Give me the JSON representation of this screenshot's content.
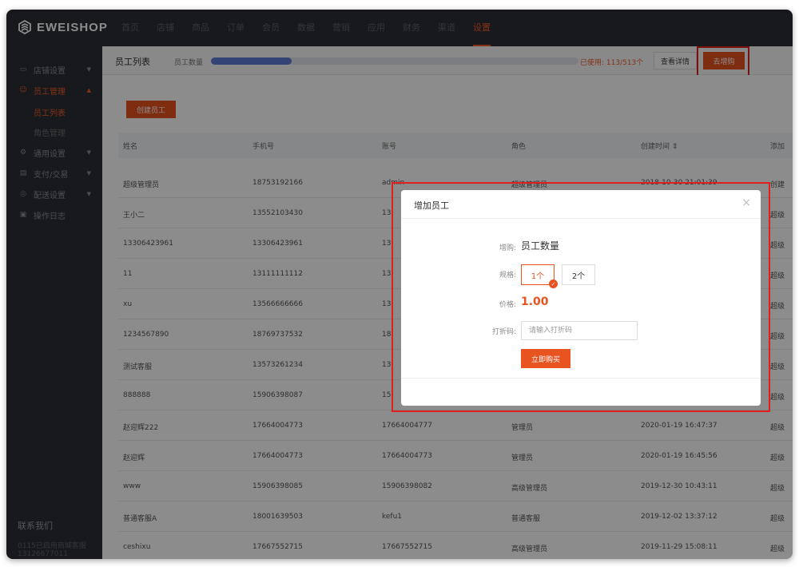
{
  "app": {
    "logo_text": "EWEISHOP"
  },
  "nav": [
    "首页",
    "店铺",
    "商品",
    "订单",
    "会员",
    "数据",
    "营销",
    "应用",
    "财务",
    "渠道",
    "设置"
  ],
  "nav_active_index": 10,
  "sidebar": {
    "groups": [
      {
        "label": "店铺设置",
        "icon": "shop-icon",
        "caret": "▼"
      },
      {
        "label": "员工管理",
        "icon": "staff-icon",
        "caret": "▲"
      },
      {
        "label": "通用设置",
        "icon": "gear-icon",
        "caret": "▼"
      },
      {
        "label": "支付/交易",
        "icon": "card-icon",
        "caret": "▼"
      },
      {
        "label": "配送设置",
        "icon": "delivery-icon",
        "caret": "▼"
      },
      {
        "label": "操作日志",
        "icon": "log-icon",
        "caret": ""
      }
    ],
    "subitems": [
      "员工列表",
      "角色管理"
    ],
    "contact_title": "联系我们",
    "contact_lines": [
      "0115已启用商城客服",
      "13126677011"
    ]
  },
  "toolbar": {
    "title": "员工列表",
    "quota_label": "员工数量",
    "usage_fraction": 0.22,
    "used_text": "已使用: 113/513个",
    "detail_button": "查看详情",
    "buy_button": "去增购"
  },
  "create_button": "创建员工",
  "table": {
    "columns": [
      "姓名",
      "手机号",
      "账号",
      "角色",
      "创建时间 ⇕",
      "添加"
    ],
    "rows": [
      [
        "超级管理员",
        "18753192166",
        "admin",
        "超级管理员",
        "2018-10-30 21:01:39",
        "创建"
      ],
      [
        "王小二",
        "13552103430",
        "13",
        "",
        "",
        "超级"
      ],
      [
        "13306423961",
        "13306423961",
        "13",
        "",
        "",
        "超级"
      ],
      [
        "11",
        "13111111112",
        "13",
        "",
        "",
        "超级"
      ],
      [
        "xu",
        "13566666666",
        "13",
        "",
        "",
        "超级"
      ],
      [
        "1234567890",
        "18769737532",
        "18",
        "",
        "",
        "超级"
      ],
      [
        "测试客服",
        "13573261234",
        "13",
        "",
        "",
        "超级"
      ],
      [
        "888888",
        "15906398087",
        "15",
        "",
        "",
        "超级"
      ],
      [
        "赵迎辉222",
        "17664004773",
        "17664004777",
        "管理员",
        "2020-01-19 16:47:37",
        "超级"
      ],
      [
        "赵迎辉",
        "17664004773",
        "17664004773",
        "管理员",
        "2020-01-19 16:45:56",
        "超级"
      ],
      [
        "www",
        "15906398085",
        "15906398082",
        "高级管理员",
        "2019-12-30 10:43:11",
        "超级"
      ],
      [
        "普通客服A",
        "18001639503",
        "kefu1",
        "普通客服",
        "2019-12-02 13:37:12",
        "超级"
      ],
      [
        "ceshixu",
        "17667552715",
        "17667552715",
        "高级管理员",
        "2019-11-29 15:08:11",
        "超级"
      ]
    ]
  },
  "modal": {
    "title": "增加员工",
    "close": "×",
    "product_label": "增购:",
    "product_value": "员工数量",
    "spec_label": "规格:",
    "specs": [
      "1个",
      "2个"
    ],
    "spec_selected_index": 0,
    "price_label": "价格:",
    "price_value": "1.00",
    "code_label": "打折码:",
    "code_placeholder": "请输入打折码",
    "code_value": "",
    "buy_button": "立即购买"
  },
  "colors": {
    "accent": "#e8531f",
    "sidebar_bg": "#2b2e33",
    "progress": "#5b7bd3",
    "highlight": "#e02020"
  }
}
